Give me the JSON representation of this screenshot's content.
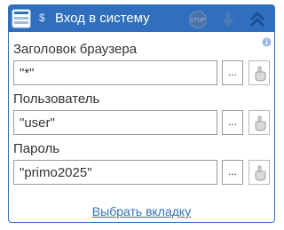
{
  "window": {
    "title": "Вход в систему",
    "dollar_sign": "$",
    "icons": {
      "app": "form-window-icon",
      "stop": "stop-icon",
      "down": "arrow-down-icon",
      "up": "double-chevron-up-icon",
      "info": "info-icon"
    }
  },
  "fields": [
    {
      "label": "Заголовок браузера",
      "value": "\"*\"",
      "dots": "..."
    },
    {
      "label": "Пользователь",
      "value": "\"user\"",
      "dots": "..."
    },
    {
      "label": "Пароль",
      "value": "\"primo2025\"",
      "dots": "..."
    }
  ],
  "footer": {
    "link": "Выбрать вкладку"
  },
  "colors": {
    "accent": "#2f6fbd",
    "text": "#333333",
    "border": "#9a9a9a"
  }
}
